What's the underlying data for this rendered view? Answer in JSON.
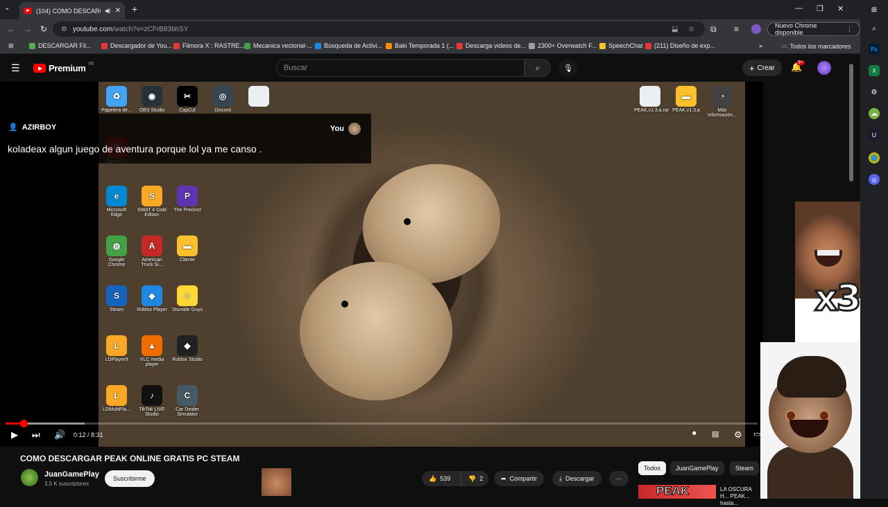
{
  "browser": {
    "tab_title": "(104) COMO DESCARGAR P",
    "new_tab": "+",
    "url_host": "youtube.com",
    "url_path": "/watch?v=zCFrB83bhSY",
    "update_label": "Nuevo Chrome disponible",
    "bookmarks": [
      {
        "label": "DESCARGAR Fil...",
        "color": "#4caf50"
      },
      {
        "label": "Descargador de You...",
        "color": "#e53935"
      },
      {
        "label": "Filmora X : RASTRE...",
        "color": "#e53935"
      },
      {
        "label": "Mecanica vectorial-...",
        "color": "#43a047"
      },
      {
        "label": "Búsqueda de Activi...",
        "color": "#1e88e5"
      },
      {
        "label": "Baki Temporada 1 (...",
        "color": "#fb8c00"
      },
      {
        "label": "Descarga videos de...",
        "color": "#e53935"
      },
      {
        "label": "2300+ Overwatch F...",
        "color": "#9e9e9e"
      },
      {
        "label": "SpeechChat",
        "color": "#fbc02d"
      },
      {
        "label": "(211) Diseño de exp...",
        "color": "#e53935"
      }
    ],
    "all_bookmarks": "Todos los marcadores"
  },
  "youtube": {
    "logo_text": "Premium",
    "logo_country": "PE",
    "search_placeholder": "Buscar",
    "create_label": "Crear",
    "notifications_badge": "9+"
  },
  "video": {
    "desktop_icons": [
      {
        "label": "Papelera de...",
        "color": "#42a5f5",
        "glyph": "♻"
      },
      {
        "label": "OBS Studio",
        "color": "#263238",
        "glyph": "◉"
      },
      {
        "label": "CapCut",
        "color": "#000000",
        "glyph": "✂"
      },
      {
        "label": "Discord",
        "color": "#37474f",
        "glyph": "◎"
      },
      {
        "label": "",
        "color": "#eceff1",
        "glyph": ""
      },
      {
        "label": "Opera GX",
        "color": "#d32f2f",
        "glyph": "O"
      },
      {
        "label": "Microsoft Edge",
        "color": "#0288d1",
        "glyph": "e"
      },
      {
        "label": "SWAT 4 Gold Edition",
        "color": "#f9a825",
        "glyph": "S"
      },
      {
        "label": "The Precinct",
        "color": "#5e35b1",
        "glyph": "P"
      },
      {
        "label": "Google Chrome",
        "color": "#43a047",
        "glyph": "◍"
      },
      {
        "label": "American Truck Si...",
        "color": "#c62828",
        "glyph": "A"
      },
      {
        "label": "Cliente",
        "color": "#fbc02d",
        "glyph": "▬"
      },
      {
        "label": "Steam",
        "color": "#1565c0",
        "glyph": "S"
      },
      {
        "label": "Roblox Player",
        "color": "#1e88e5",
        "glyph": "◆"
      },
      {
        "label": "Stumble Guys",
        "color": "#fdd835",
        "glyph": "☺"
      },
      {
        "label": "LDPlayer9",
        "color": "#f9a825",
        "glyph": "L"
      },
      {
        "label": "VLC media player",
        "color": "#ef6c00",
        "glyph": "▲"
      },
      {
        "label": "Roblox Studio",
        "color": "#212121",
        "glyph": "◆"
      },
      {
        "label": "LDMultiPla...",
        "color": "#f9a825",
        "glyph": "L"
      },
      {
        "label": "TikTok LIVE Studio",
        "color": "#111111",
        "glyph": "♪"
      },
      {
        "label": "Car Dealer Simulator",
        "color": "#455a64",
        "glyph": "C"
      },
      {
        "label": "PEAK.v1.3.a.rar",
        "color": "#eceff1",
        "glyph": ""
      },
      {
        "label": "PEAK.v1.3.a",
        "color": "#fbc02d",
        "glyph": "▬"
      },
      {
        "label": "Más información...",
        "color": "#424242",
        "glyph": "◔"
      }
    ],
    "chat_user": "AZIRBOY",
    "chat_you": "You",
    "chat_message": "koladeax algun juego de aventura porque lol ya me canso .",
    "meme_text": "x3",
    "progress_played": 0.024,
    "progress_loaded": 0.105,
    "time_current": "0:12",
    "time_total": "8:31",
    "timecode": "0:12 / 8:31"
  },
  "below": {
    "title": "COMO DESCARGAR PEAK ONLINE GRATIS PC STEAM",
    "channel_name": "JuanGamePlay",
    "channel_subs": "3,5 K suscriptores",
    "subscribe_label": "Suscribirme",
    "likes": "539",
    "dislikes": "2",
    "share_label": "Compartir",
    "download_label": "Descargar",
    "chips": [
      "Todos",
      "JuanGamePlay",
      "Steam"
    ],
    "rec_thumb_text": "PEAK",
    "rec_title": "LA OSCURA H... PEAK... hasta..."
  },
  "colors": {
    "yt_red": "#ff0000",
    "background": "#0f0f0f"
  }
}
